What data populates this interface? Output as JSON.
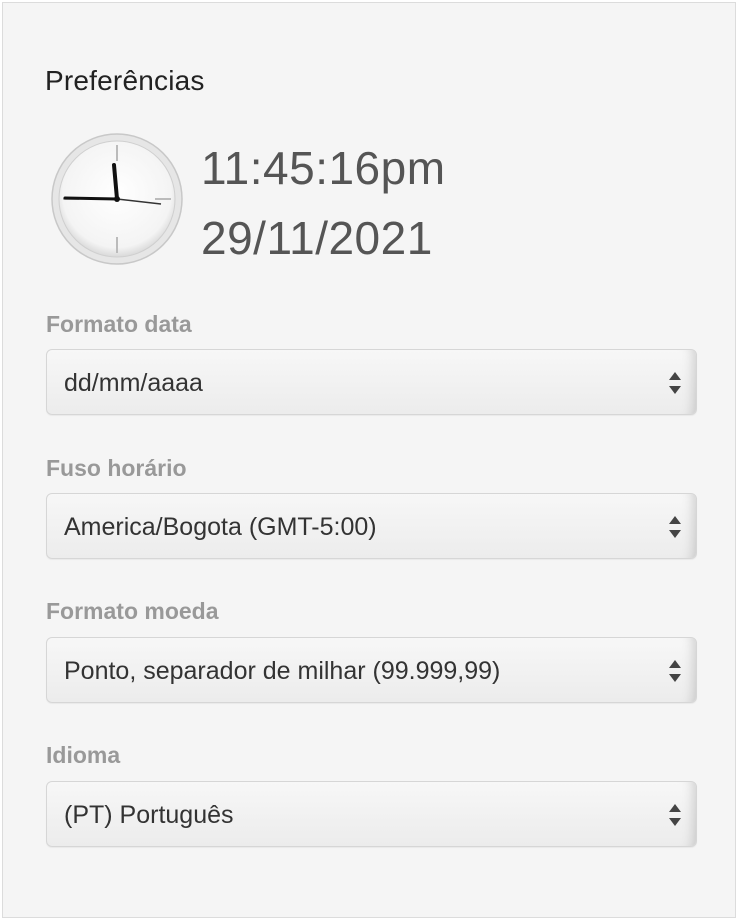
{
  "panel": {
    "title": "Preferências"
  },
  "clock": {
    "icon": "analog-clock-icon",
    "time": "11:45:16pm",
    "date": "29/11/2021"
  },
  "fields": [
    {
      "label": "Formato data",
      "value": "dd/mm/aaaa"
    },
    {
      "label": "Fuso horário",
      "value": "America/Bogota (GMT-5:00)"
    },
    {
      "label": "Formato moeda",
      "value": "Ponto, separador de milhar (99.999,99)"
    },
    {
      "label": "Idioma",
      "value": "(PT) Português"
    }
  ]
}
